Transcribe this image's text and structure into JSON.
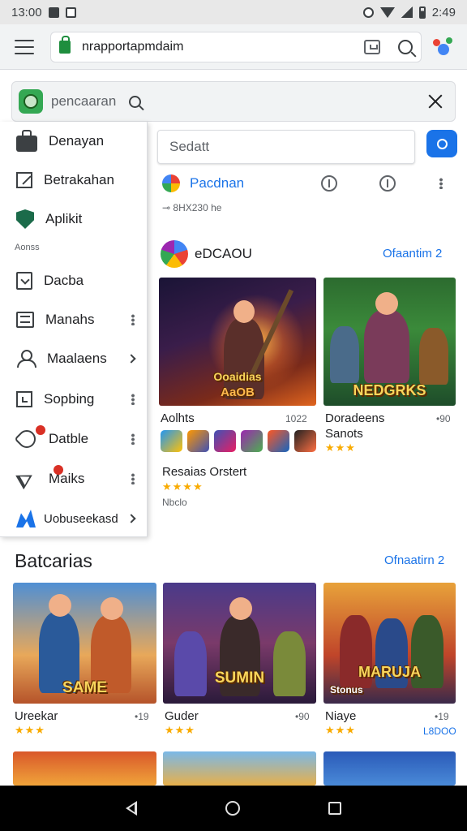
{
  "status_bar": {
    "time_left": "13:00",
    "right_time": "2:49"
  },
  "browser": {
    "url": "nrapportapmdaim"
  },
  "page_search": {
    "placeholder": "pencaaran"
  },
  "drawer": {
    "items": [
      {
        "label": "Denayan",
        "icon": "shopping-bag-icon"
      },
      {
        "label": "Betrakahan",
        "icon": "edit-icon"
      },
      {
        "label": "Aplikit",
        "icon": "shield-icon"
      },
      {
        "label": "Dacba",
        "icon": "download-icon"
      },
      {
        "label": "Manahs",
        "icon": "list-icon"
      },
      {
        "label": "Maalaens",
        "icon": "person-icon"
      },
      {
        "label": "Sopbing",
        "icon": "frame-icon"
      },
      {
        "label": "Datble",
        "icon": "tag-icon"
      },
      {
        "label": "Maiks",
        "icon": "send-icon"
      },
      {
        "label": "Uobuseekasd",
        "icon": "blue-logo-icon"
      }
    ],
    "caption": "Aonss"
  },
  "main": {
    "inner_search_placeholder": "Sedatt",
    "pac_title": "Pacdnan",
    "pac_sub": "⊸ 8HX230 he",
    "section1": {
      "title": "eDCAOU",
      "link": "Ofaantim 2"
    },
    "card1": {
      "overlay_line1": "Ooaidias",
      "overlay_line2": "AaOB",
      "name": "Aolhts",
      "meta": "1022"
    },
    "card2": {
      "overlay": "NEDGRKS",
      "name": "Doradeens",
      "sub": "Sanots",
      "meta": "•90",
      "stars": "★★★"
    },
    "card1_below": {
      "title": "Resaias Orstert",
      "stars": "★★★★",
      "extra": "Nbclo"
    },
    "section2": {
      "title": "Batcarias",
      "link": "Ofnaatirn 2"
    },
    "row2": [
      {
        "overlay": "SAME",
        "name": "Ureekar",
        "meta": "•19",
        "stars": "★★★"
      },
      {
        "overlay": "SUMIN",
        "name": "Guder",
        "meta": "•90",
        "stars": "★★★"
      },
      {
        "overlay": "MARUJA",
        "overlay_sub": "Stonus",
        "name": "Niaye",
        "meta": "•19",
        "stars": "★★★",
        "extra": "L8DOO"
      }
    ]
  },
  "colors": {
    "accent": "#1a73e8",
    "star": "#f9ab00",
    "brand_green": "#34a853"
  }
}
